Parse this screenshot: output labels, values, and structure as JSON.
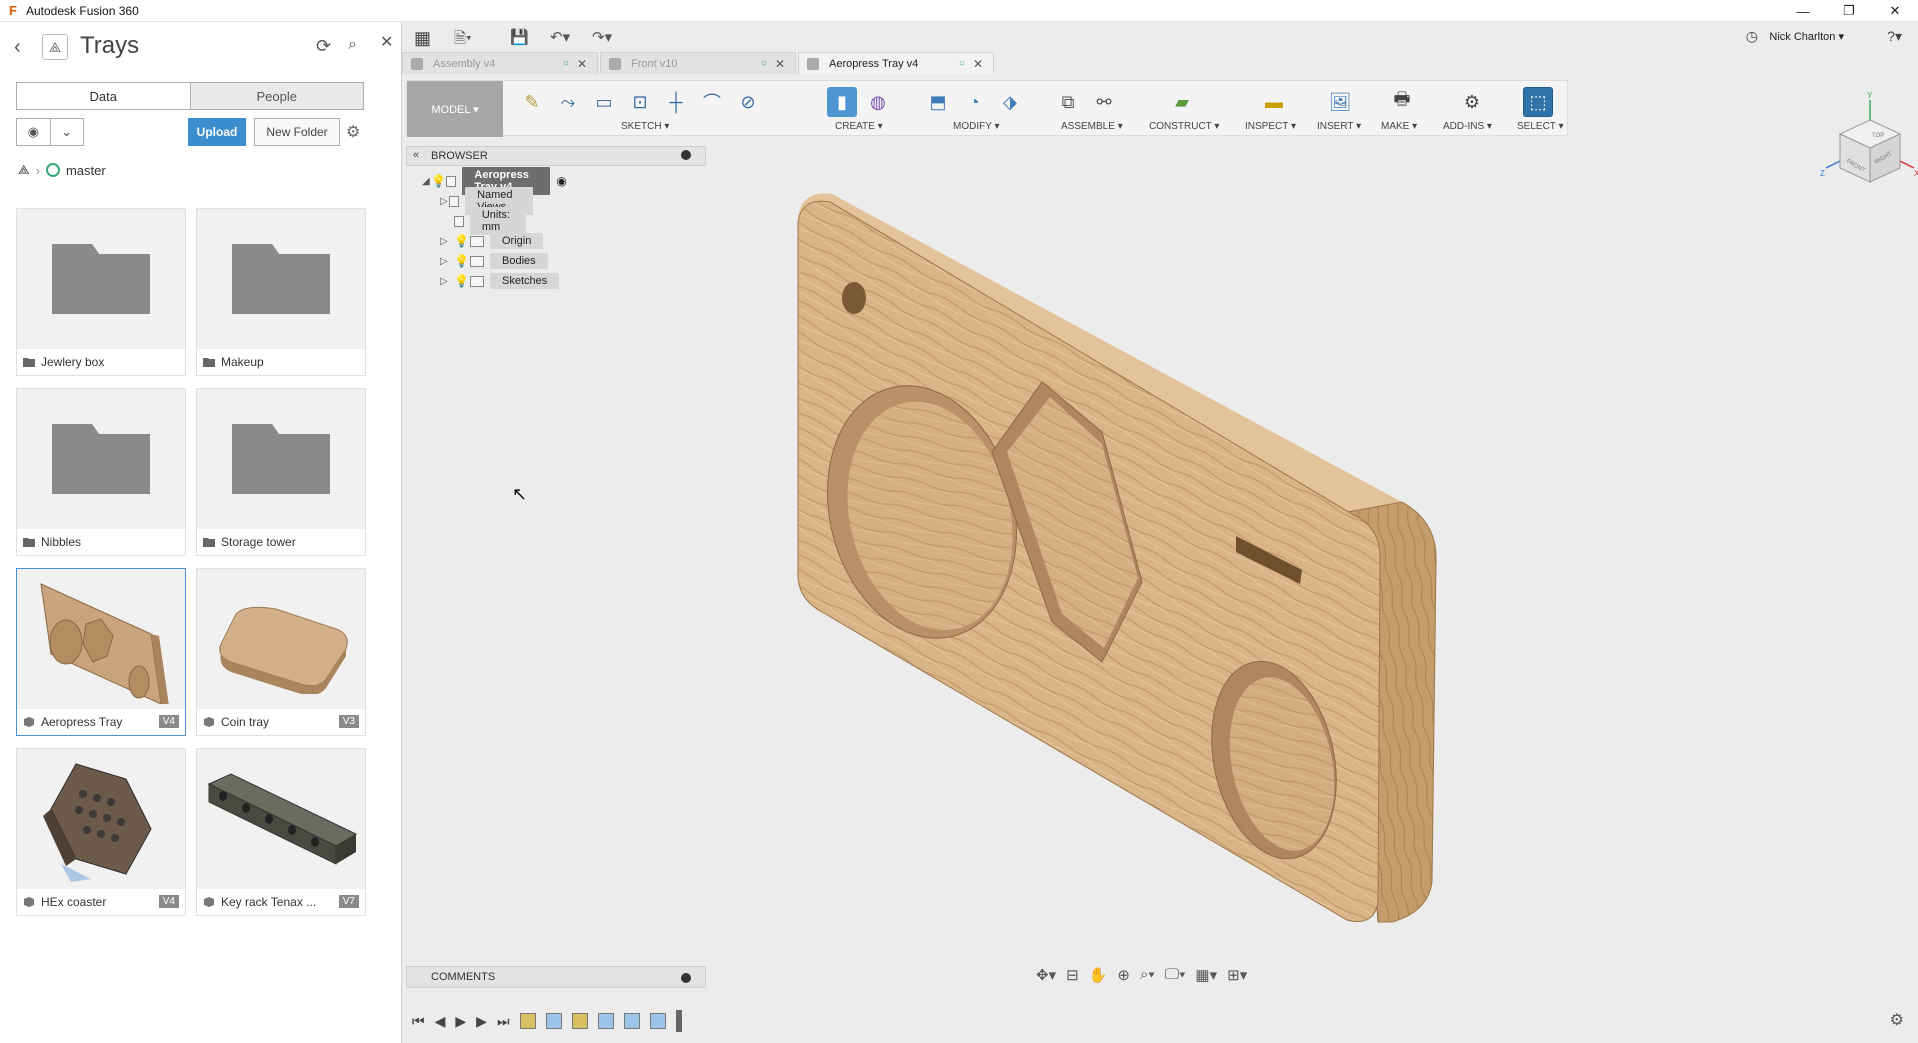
{
  "window": {
    "title": "Autodesk Fusion 360",
    "minimize": "—",
    "restore": "❐",
    "close": "✕"
  },
  "data_panel": {
    "project_title": "Trays",
    "tabs": [
      "Data",
      "People"
    ],
    "upload_label": "Upload",
    "new_folder_label": "New Folder",
    "breadcrumb": "master",
    "items": [
      {
        "name": "Jewlery box",
        "type": "folder",
        "version": ""
      },
      {
        "name": "Makeup",
        "type": "folder",
        "version": ""
      },
      {
        "name": "Nibbles",
        "type": "folder",
        "version": ""
      },
      {
        "name": "Storage tower",
        "type": "folder",
        "version": ""
      },
      {
        "name": "Aeropress Tray",
        "type": "design",
        "version": "V4"
      },
      {
        "name": "Coin tray",
        "type": "design",
        "version": "V3"
      },
      {
        "name": "HEx coaster",
        "type": "design",
        "version": "V4"
      },
      {
        "name": "Key rack Tenax ...",
        "type": "design",
        "version": "V7"
      }
    ]
  },
  "document_tabs": [
    {
      "label": "Assembly v4",
      "active": false
    },
    {
      "label": "Front v10",
      "active": false
    },
    {
      "label": "Aeropress Tray v4",
      "active": true
    }
  ],
  "user": {
    "name": "Nick Charlton ▾"
  },
  "toolbar": {
    "workspace": "MODEL ▾",
    "groups": [
      {
        "label": "SKETCH ▾"
      },
      {
        "label": "CREATE ▾"
      },
      {
        "label": "MODIFY ▾"
      },
      {
        "label": "ASSEMBLE ▾"
      },
      {
        "label": "CONSTRUCT ▾"
      },
      {
        "label": "INSPECT ▾"
      },
      {
        "label": "INSERT ▾"
      },
      {
        "label": "MAKE ▾"
      },
      {
        "label": "ADD-INS ▾"
      },
      {
        "label": "SELECT ▾"
      }
    ]
  },
  "browser": {
    "title": "BROWSER",
    "root": "Aeropress Tray v4",
    "nodes": [
      "Named Views",
      "Units: mm",
      "Origin",
      "Bodies",
      "Sketches"
    ]
  },
  "comments": {
    "title": "COMMENTS"
  },
  "viewcube": {
    "top": "TOP",
    "front": "FRONT",
    "right": "RIGHT",
    "x": "X",
    "y": "Y",
    "z": "Z"
  },
  "colors": {
    "wood": "#d9b48a",
    "wood_dark": "#b8905f",
    "accent": "#3c8dce",
    "select": "#2f73a8"
  }
}
